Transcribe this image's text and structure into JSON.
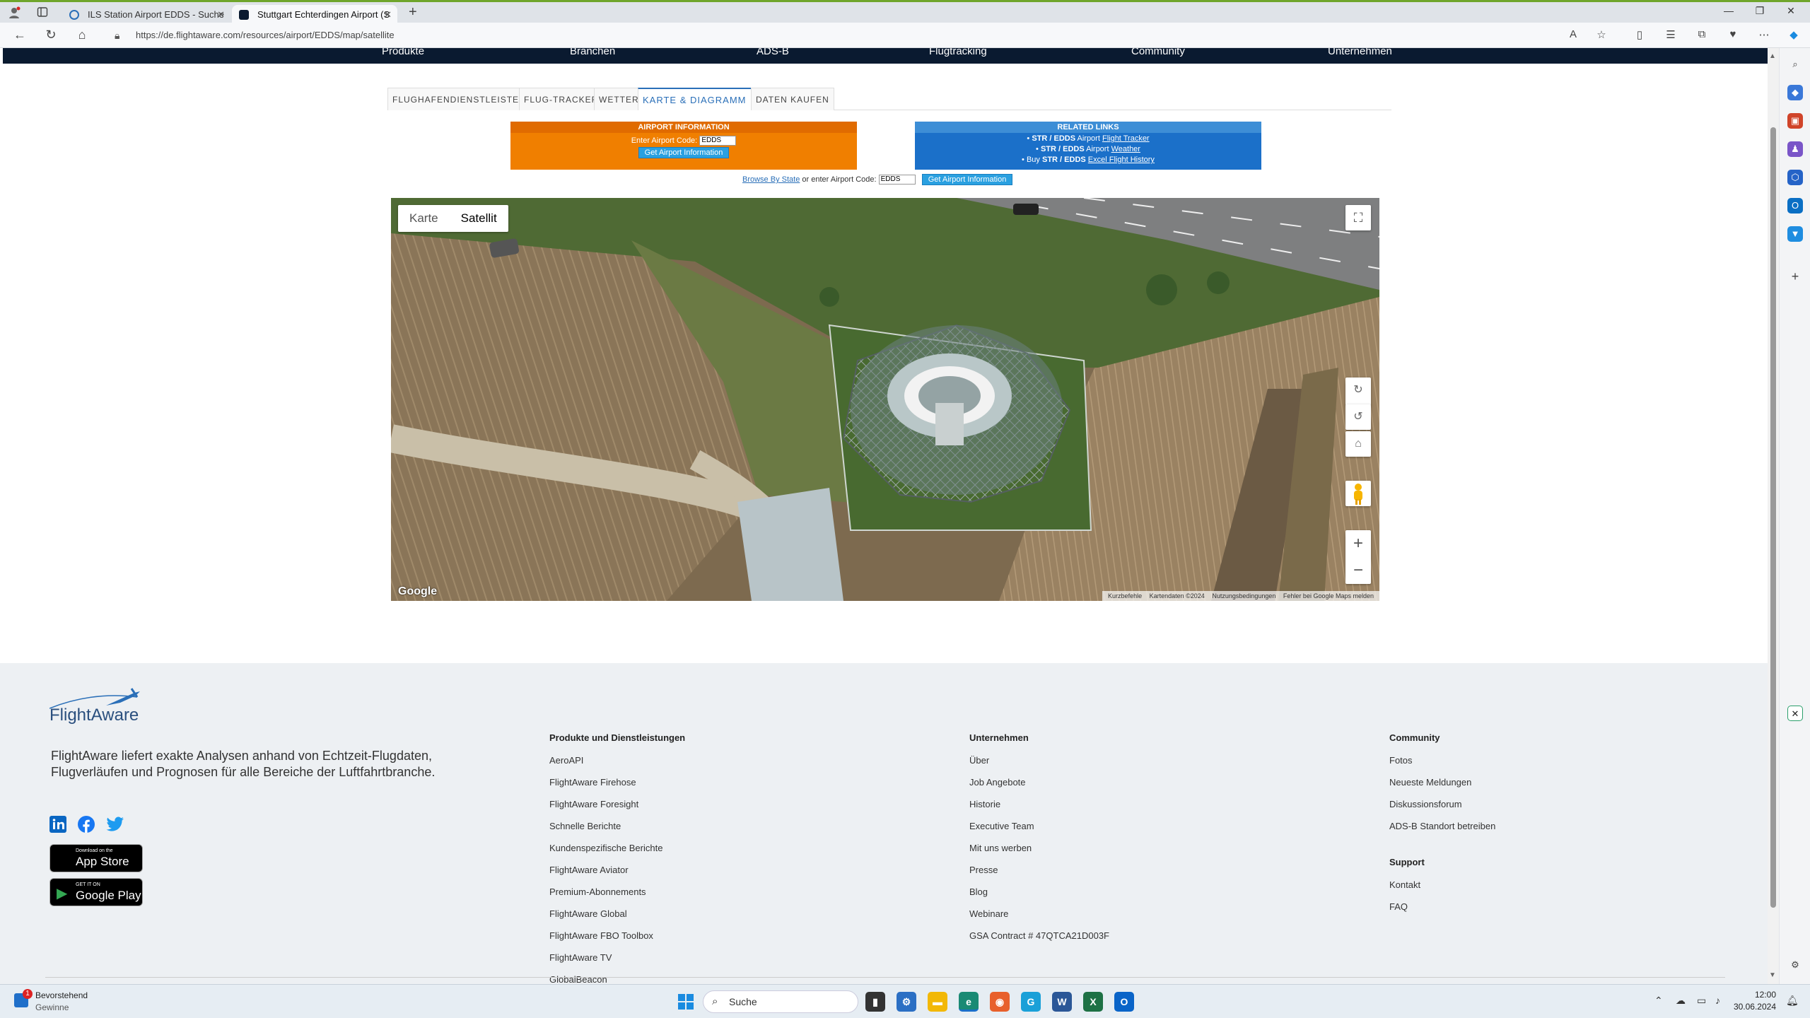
{
  "browser": {
    "tabs": [
      {
        "title": "ILS Station Airport EDDS - Suche"
      },
      {
        "title": "Stuttgart Echterdingen Airport (S"
      }
    ],
    "url": "https://de.flightaware.com/resources/airport/EDDS/map/satellite"
  },
  "nav": {
    "items": [
      "Produkte",
      "Branchen",
      "ADS-B",
      "Flugtracking",
      "Community",
      "Unternehmen"
    ]
  },
  "subtabs": [
    {
      "label": "FLUGHAFENDIENSTLEISTER"
    },
    {
      "label": "FLUG-TRACKER"
    },
    {
      "label": "WETTER"
    },
    {
      "label": "KARTE & DIAGRAMM"
    },
    {
      "label": "DATEN KAUFEN"
    }
  ],
  "airport_info": {
    "header": "AIRPORT INFORMATION",
    "label": "Enter Airport Code:",
    "code": "EDDS",
    "button": "Get Airport Information"
  },
  "related": {
    "header": "RELATED LINKS",
    "links": [
      {
        "code": "STR / EDDS",
        "middle": "Airport",
        "link": "Flight Tracker",
        "prefix": ""
      },
      {
        "code": "STR / EDDS",
        "middle": "Airport",
        "link": "Weather",
        "prefix": ""
      },
      {
        "code": "STR / EDDS",
        "middle": "",
        "link": "Excel Flight History",
        "prefix": "Buy"
      }
    ]
  },
  "browse": {
    "link": "Browse By State",
    "text": "or enter Airport Code:",
    "code": "EDDS",
    "button": "Get Airport Information"
  },
  "map": {
    "type_map": "Karte",
    "type_satellite": "Satellit",
    "brand": "Google",
    "attribution": [
      "Kurzbefehle",
      "Kartendaten ©2024",
      "Nutzungsbedingungen",
      "Fehler bei Google Maps melden"
    ]
  },
  "footer": {
    "logo_text": "FlightAware",
    "tagline": "FlightAware liefert exakte Analysen anhand von Echtzeit-Flugdaten, Flugverläufen und Prognosen für alle Bereiche der Luftfahrtbranche.",
    "appstore": {
      "small": "Download on the",
      "big": "App Store"
    },
    "googleplay": {
      "small": "GET IT ON",
      "big": "Google Play"
    },
    "columns": [
      {
        "title": "Produkte und Dienstleistungen",
        "links": [
          "AeroAPI",
          "FlightAware Firehose",
          "FlightAware Foresight",
          "Schnelle Berichte",
          "Kundenspezifische Berichte",
          "FlightAware Aviator",
          "Premium-Abonnements",
          "FlightAware Global",
          "FlightAware FBO Toolbox",
          "FlightAware TV",
          "GlobalBeacon"
        ]
      },
      {
        "title": "Unternehmen",
        "links": [
          "Über",
          "Job Angebote",
          "Historie",
          "Executive Team",
          "Mit uns werben",
          "Presse",
          "Blog",
          "Webinare",
          "GSA Contract # 47QTCA21D003F"
        ]
      },
      {
        "title": "Community",
        "links": [
          "Fotos",
          "Neueste Meldungen",
          "Diskussionsforum",
          "ADS-B Standort betreiben"
        ]
      },
      {
        "title": "Support",
        "links": [
          "Kontakt",
          "FAQ"
        ]
      }
    ]
  },
  "taskbar": {
    "weather_title": "Bevorstehend",
    "weather_sub": "Gewinne",
    "badge": "1",
    "search": "Suche",
    "time": "12:00",
    "date": "30.06.2024"
  },
  "colors": {
    "orange": "#f07f00",
    "blue": "#1b70c9",
    "nav": "#0a1a30",
    "footer": "#edf0f3"
  }
}
